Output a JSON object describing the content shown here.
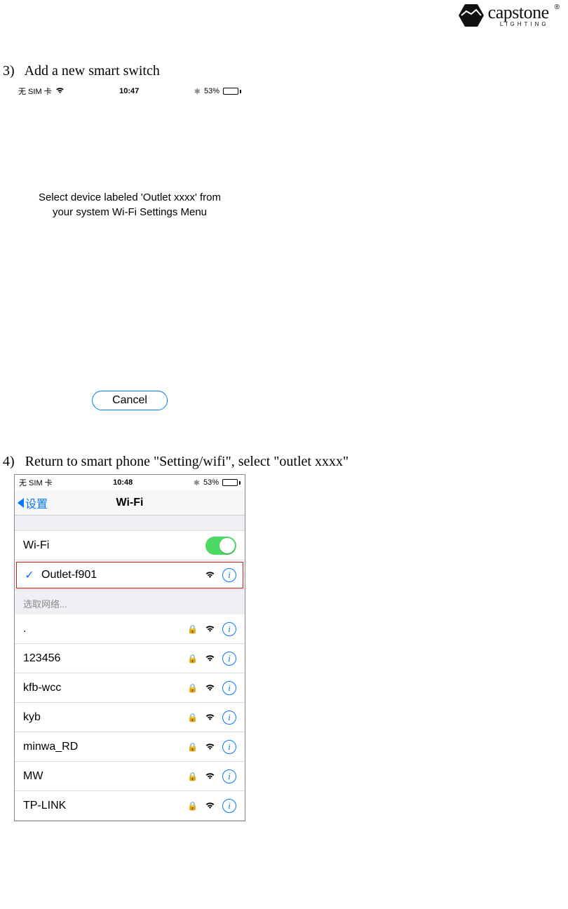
{
  "brand": {
    "name": "capstone",
    "sub": "LIGHTING",
    "reg": "®"
  },
  "step3": {
    "num": "3)",
    "text": "Add a new smart switch"
  },
  "phone1": {
    "status": {
      "sim": "无 SIM 卡",
      "time": "10:47",
      "battery_pct": "53%"
    },
    "message_l1": "Select device labeled 'Outlet xxxx' from",
    "message_l2": "your system Wi-Fi Settings Menu",
    "cancel": "Cancel"
  },
  "step4": {
    "num": "4)",
    "text": "Return to smart phone \"Setting/wifi\", select \"outlet xxxx\""
  },
  "phone2": {
    "status": {
      "sim": "无 SIM 卡",
      "time": "10:48",
      "battery_pct": "53%"
    },
    "nav_back": "设置",
    "nav_title": "Wi-Fi",
    "wifi_label": "Wi-Fi",
    "connected": {
      "name": "Outlet-f901"
    },
    "choose_label": "选取网络...",
    "networks": [
      {
        "name": ".",
        "locked": true
      },
      {
        "name": "123456",
        "locked": true
      },
      {
        "name": "kfb-wcc",
        "locked": true
      },
      {
        "name": "kyb",
        "locked": true
      },
      {
        "name": "minwa_RD",
        "locked": true
      },
      {
        "name": "MW",
        "locked": true
      },
      {
        "name": "TP-LINK",
        "locked": true
      }
    ]
  }
}
